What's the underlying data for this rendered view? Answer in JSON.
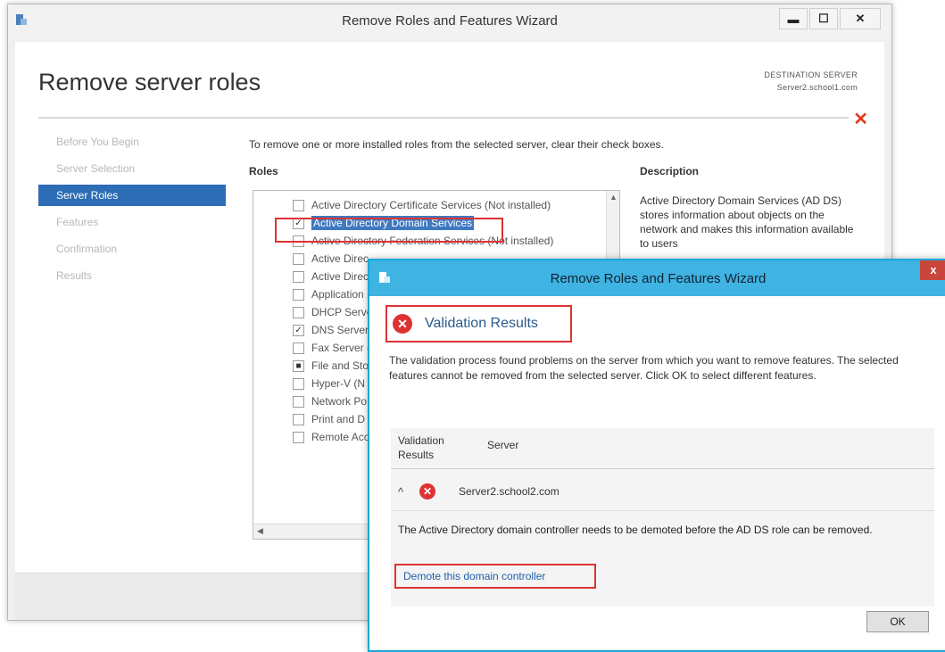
{
  "main_window": {
    "title": "Remove Roles and Features Wizard",
    "page_title": "Remove server roles",
    "destination_label": "DESTINATION SERVER",
    "destination_server": "Server2.school1.com",
    "nav": [
      {
        "label": "Before You Begin"
      },
      {
        "label": "Server Selection"
      },
      {
        "label": "Server Roles"
      },
      {
        "label": "Features"
      },
      {
        "label": "Confirmation"
      },
      {
        "label": "Results"
      }
    ],
    "instruction": "To remove one or more installed roles from the selected server, clear their check boxes.",
    "roles_header": "Roles",
    "description_header": "Description",
    "description_text": "Active Directory Domain Services (AD DS) stores information about objects on the network and makes this information available to users",
    "roles": [
      {
        "label": "Active Directory Certificate Services (Not installed)",
        "check": ""
      },
      {
        "label": "Active Directory Domain Services",
        "check": "✓"
      },
      {
        "label": "Active Directory Federation Services (Not installed)",
        "check": ""
      },
      {
        "label": "Active Direc",
        "check": ""
      },
      {
        "label": "Active Direc",
        "check": ""
      },
      {
        "label": "Application",
        "check": ""
      },
      {
        "label": "DHCP Serve",
        "check": ""
      },
      {
        "label": "DNS Server",
        "check": "✓"
      },
      {
        "label": "Fax Server (",
        "check": ""
      },
      {
        "label": "File and Sto",
        "check": "■"
      },
      {
        "label": "Hyper-V (N",
        "check": ""
      },
      {
        "label": "Network Po",
        "check": ""
      },
      {
        "label": "Print and D",
        "check": ""
      },
      {
        "label": "Remote Acc",
        "check": ""
      }
    ],
    "close_x": "✕"
  },
  "dialog": {
    "title": "Remove Roles and Features Wizard",
    "close": "x",
    "heading": "Validation Results",
    "message": "The validation process found problems on the server from which you want to remove features. The selected features cannot be removed from the selected server.  Click OK to select different features.",
    "col_validation": "Validation Results",
    "col_server": "Server",
    "server_name": "Server2.school2.com",
    "detail": "The Active Directory domain controller needs to be demoted before the AD DS role can be removed.",
    "demote_link": "Demote this domain controller",
    "ok_label": "OK"
  },
  "colors": {
    "accent": "#2d6db5",
    "error": "#dd3333",
    "dialog_border": "#19a7d8"
  }
}
